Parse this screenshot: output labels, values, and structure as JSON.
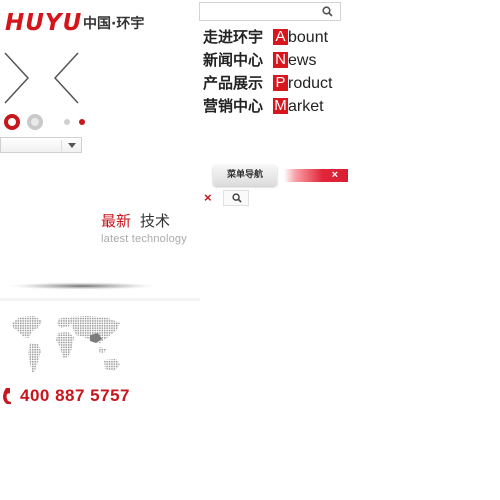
{
  "logo": {
    "brand": "HUYU",
    "chinese": "中国·环宇"
  },
  "menu": {
    "items": [
      {
        "cn": "走进环宇",
        "initial": "A",
        "rest": "bount"
      },
      {
        "cn": "新闻中心",
        "initial": "N",
        "rest": "ews"
      },
      {
        "cn": "产品展示",
        "initial": "P",
        "rest": "roduct"
      },
      {
        "cn": "营销中心",
        "initial": "M",
        "rest": "arket"
      }
    ]
  },
  "nav": {
    "menu_button_label": "菜单导航",
    "close_glyph": "×",
    "close_small_glyph": "×"
  },
  "section": {
    "title_highlight": "最新",
    "title_rest": "技术",
    "subtitle": "latest technology"
  },
  "contact": {
    "phone": "400 887 5757"
  },
  "colors": {
    "brand_red": "#c8161d",
    "text_dark": "#222222",
    "muted": "#aaaaaa"
  },
  "icons": [
    "search-icon",
    "phone-icon",
    "close-icon",
    "chevron-down-icon",
    "world-map"
  ]
}
